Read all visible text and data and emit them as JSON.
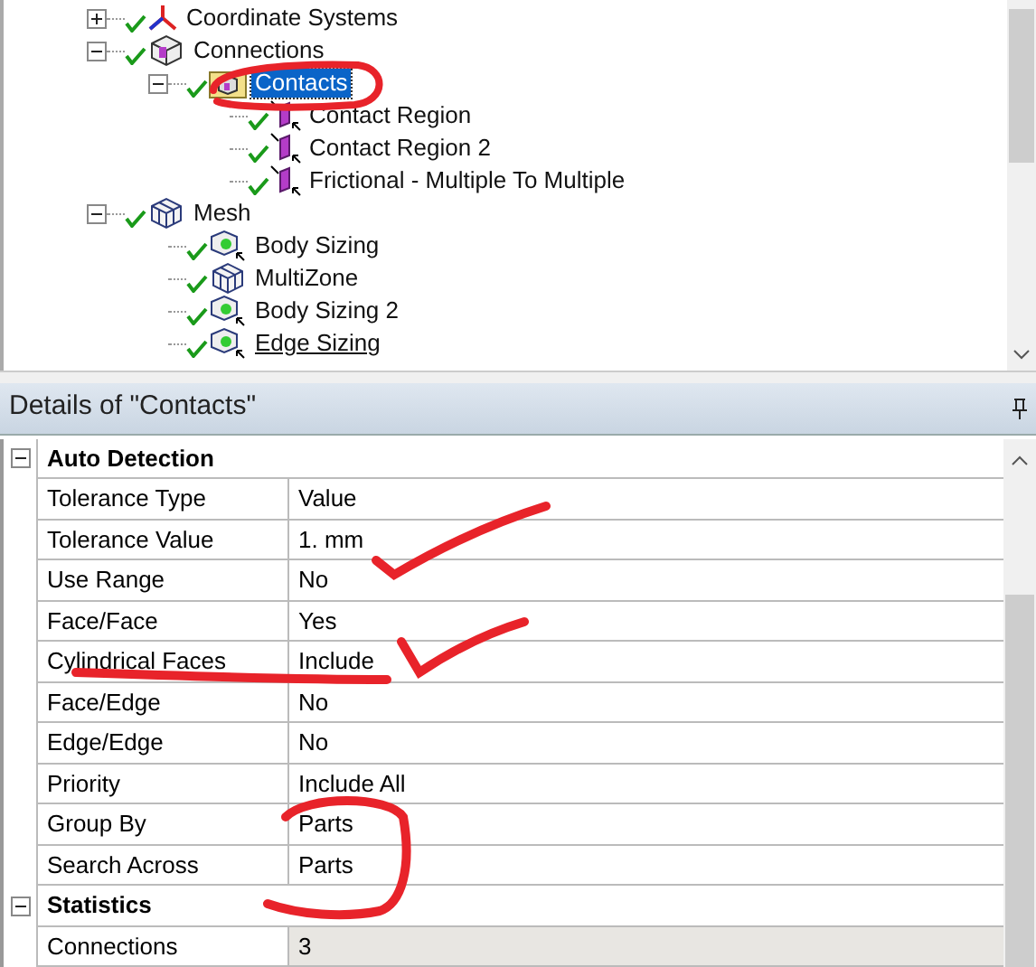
{
  "tree": [
    {
      "label": "Coordinate Systems",
      "kind": "axes",
      "ok": true,
      "selected": false,
      "underlined": false,
      "expanded": false
    },
    {
      "label": "Connections",
      "kind": "connections",
      "ok": true,
      "selected": false,
      "underlined": false,
      "expanded": true,
      "children": [
        {
          "label": "Contacts",
          "kind": "folder",
          "ok": true,
          "selected": true,
          "underlined": false,
          "expanded": true,
          "children": [
            {
              "label": "Contact Region",
              "kind": "contact",
              "ok": true,
              "selected": false,
              "underlined": false
            },
            {
              "label": "Contact Region 2",
              "kind": "contact",
              "ok": true,
              "selected": false,
              "underlined": false
            },
            {
              "label": "Frictional - Multiple To Multiple",
              "kind": "contact",
              "ok": true,
              "selected": false,
              "underlined": false
            }
          ]
        }
      ]
    },
    {
      "label": "Mesh",
      "kind": "mesh",
      "ok": true,
      "selected": false,
      "underlined": false,
      "expanded": true,
      "children": [
        {
          "label": "Body Sizing",
          "kind": "sizing",
          "ok": true,
          "selected": false,
          "underlined": false
        },
        {
          "label": "MultiZone",
          "kind": "mesh",
          "ok": true,
          "selected": false,
          "underlined": false
        },
        {
          "label": "Body Sizing 2",
          "kind": "sizing",
          "ok": true,
          "selected": false,
          "underlined": false
        },
        {
          "label": "Edge Sizing",
          "kind": "sizing",
          "ok": true,
          "selected": false,
          "underlined": true
        }
      ]
    }
  ],
  "details": {
    "title": "Details of \"Contacts\"",
    "sections": [
      {
        "title": "Auto Detection",
        "expanded": true,
        "rows": [
          {
            "label": "Tolerance Type",
            "value": "Value",
            "readonly": false
          },
          {
            "label": "Tolerance Value",
            "value": "1. mm",
            "readonly": false
          },
          {
            "label": "Use Range",
            "value": "No",
            "readonly": false
          },
          {
            "label": "Face/Face",
            "value": "Yes",
            "readonly": false
          },
          {
            "label": "Cylindrical Faces",
            "value": "Include",
            "readonly": false
          },
          {
            "label": "Face/Edge",
            "value": "No",
            "readonly": false
          },
          {
            "label": "Edge/Edge",
            "value": "No",
            "readonly": false
          },
          {
            "label": "Priority",
            "value": "Include All",
            "readonly": false
          },
          {
            "label": "Group By",
            "value": "Parts",
            "readonly": false
          },
          {
            "label": "Search Across",
            "value": "Parts",
            "readonly": false
          }
        ]
      },
      {
        "title": "Statistics",
        "expanded": true,
        "rows": [
          {
            "label": "Connections",
            "value": "3",
            "readonly": true
          }
        ]
      }
    ]
  }
}
